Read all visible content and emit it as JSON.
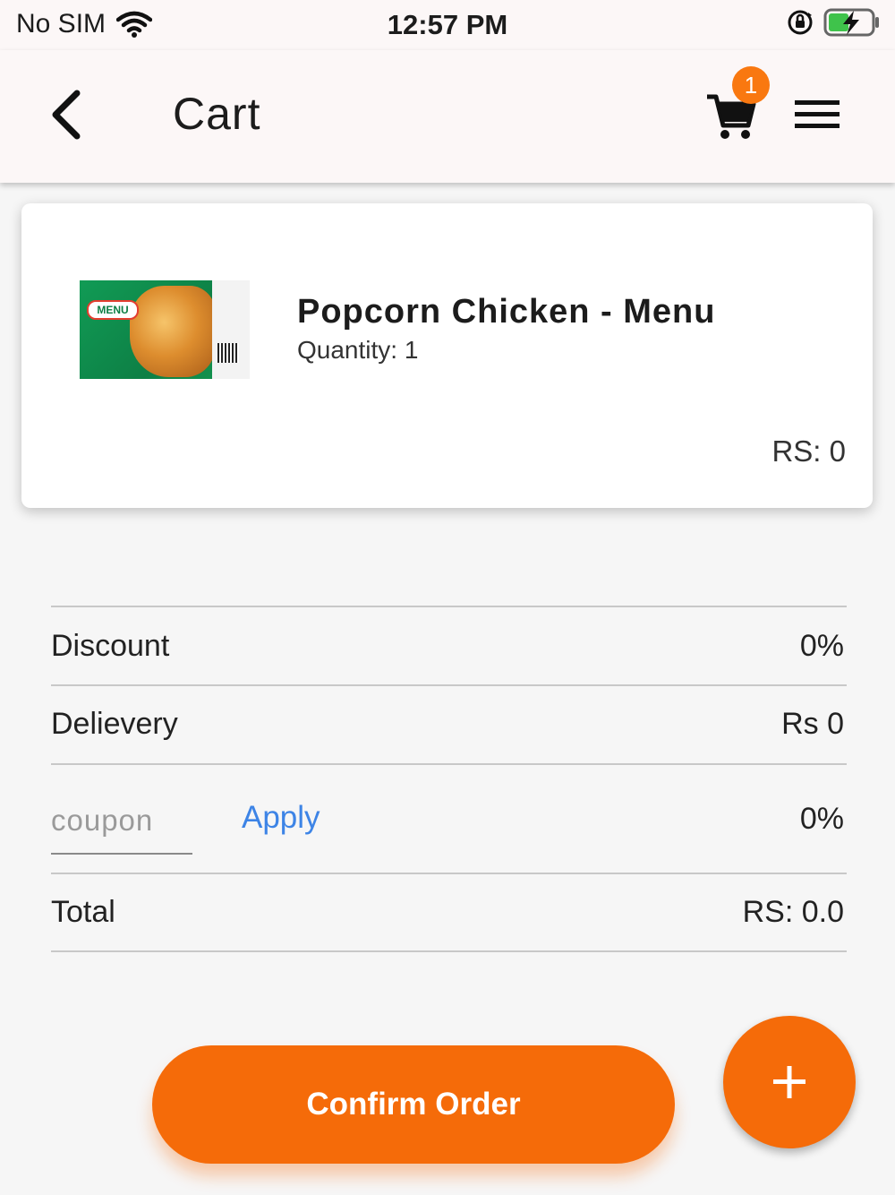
{
  "status_bar": {
    "carrier": "No SIM",
    "time": "12:57 PM"
  },
  "app_bar": {
    "title": "Cart",
    "cart_badge_count": "1"
  },
  "cart_items": [
    {
      "name": "Popcorn Chicken - Menu",
      "quantity_text": "Quantity: 1",
      "price_text": "RS: 0",
      "image_logo": "MENU"
    }
  ],
  "summary": {
    "discount_label": "Discount",
    "discount_value": "0%",
    "delivery_label": "Delievery",
    "delivery_value": "Rs 0",
    "coupon_placeholder": "coupon",
    "apply_label": "Apply",
    "coupon_value": "0%",
    "total_label": "Total",
    "total_value": "RS: 0.0"
  },
  "actions": {
    "confirm_label": "Confirm Order",
    "fab_icon": "plus-icon"
  },
  "colors": {
    "accent": "#f56b09",
    "badge": "#f97810",
    "link": "#3d84e6"
  }
}
